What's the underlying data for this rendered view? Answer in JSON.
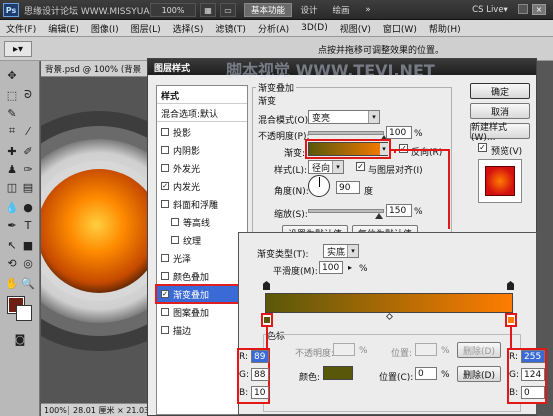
{
  "titlebar": {
    "logo": "Ps",
    "watermark": "思缘设计论坛 WWW.MISSYUAN.COM",
    "zoom": "100%",
    "workspace_buttons": [
      "基本功能",
      "设计",
      "绘画",
      "»"
    ],
    "cs_live": "CS Live▾"
  },
  "menubar": [
    "文件(F)",
    "编辑(E)",
    "图像(I)",
    "图层(L)",
    "选择(S)",
    "滤镜(T)",
    "分析(A)",
    "3D(D)",
    "视图(V)",
    "窗口(W)",
    "帮助(H)"
  ],
  "options_hint": "点按并拖移可调整效果的位置。",
  "document": {
    "tab": "背景.psd @ 100% (背景",
    "status_zoom": "100%",
    "status_size": "28.01 厘米 × 21.03 厘米 (72 ppi)"
  },
  "dialog": {
    "title": "图层样式",
    "watermark": "脚本视觉 WWW.TEVI.NET",
    "styles_header": "样式",
    "blend_defaults": "混合选项:默认",
    "styles": [
      {
        "label": "投影",
        "checked": false
      },
      {
        "label": "内阴影",
        "checked": false
      },
      {
        "label": "外发光",
        "checked": false
      },
      {
        "label": "内发光",
        "checked": true
      },
      {
        "label": "斜面和浮雕",
        "checked": false
      },
      {
        "label": "等高线",
        "checked": false
      },
      {
        "label": "纹理",
        "checked": false
      },
      {
        "label": "光泽",
        "checked": false
      },
      {
        "label": "颜色叠加",
        "checked": false
      },
      {
        "label": "渐变叠加",
        "checked": true
      },
      {
        "label": "图案叠加",
        "checked": false
      },
      {
        "label": "描边",
        "checked": false
      }
    ],
    "section_title": "渐变叠加",
    "group_title": "渐变",
    "blend_mode_label": "混合模式(O):",
    "blend_mode": "变亮",
    "opacity_label": "不透明度(P):",
    "opacity": "100",
    "opacity_value": 1.0,
    "gradient_label": "渐变:",
    "reverse_label": "反向(R)",
    "style_label": "样式(L):",
    "style_value": "径向",
    "align_label": "与图层对齐(I)",
    "angle_label": "角度(N):",
    "angle": "90",
    "degree": "度",
    "scale_label": "缩放(S):",
    "scale": "150",
    "scale_value": 1.5,
    "percent": "%",
    "btn_set_default": "设置为默认值",
    "btn_reset_default": "复位为默认值",
    "ok": "确定",
    "cancel": "取消",
    "new_style": "新建样式(W)...",
    "preview_label": "预览(V)"
  },
  "editor": {
    "grad_type_label": "渐变类型(T):",
    "grad_type": "实底",
    "smooth_label": "平滑度(M):",
    "smooth": "100",
    "percent": "%",
    "stops_title": "色标",
    "opacity_label": "不透明度:",
    "location_label": "位置:",
    "delete_label": "删除(D)",
    "color_label": "颜色:",
    "location2_label": "位置(C):",
    "location_value": "0",
    "left_rgb": {
      "r_label": "R:",
      "g_label": "G:",
      "b_label": "B:",
      "r": "89",
      "g": "88",
      "b": "10"
    },
    "right_rgb": {
      "r_label": "R:",
      "g_label": "G:",
      "b_label": "B:",
      "r": "255",
      "g": "124",
      "b": "0"
    }
  },
  "colors": {
    "gradient_start": "#59580a",
    "gradient_end": "#ff7c00",
    "accent_red": "#e01818",
    "foreground_swatch": "#6e1f14"
  }
}
